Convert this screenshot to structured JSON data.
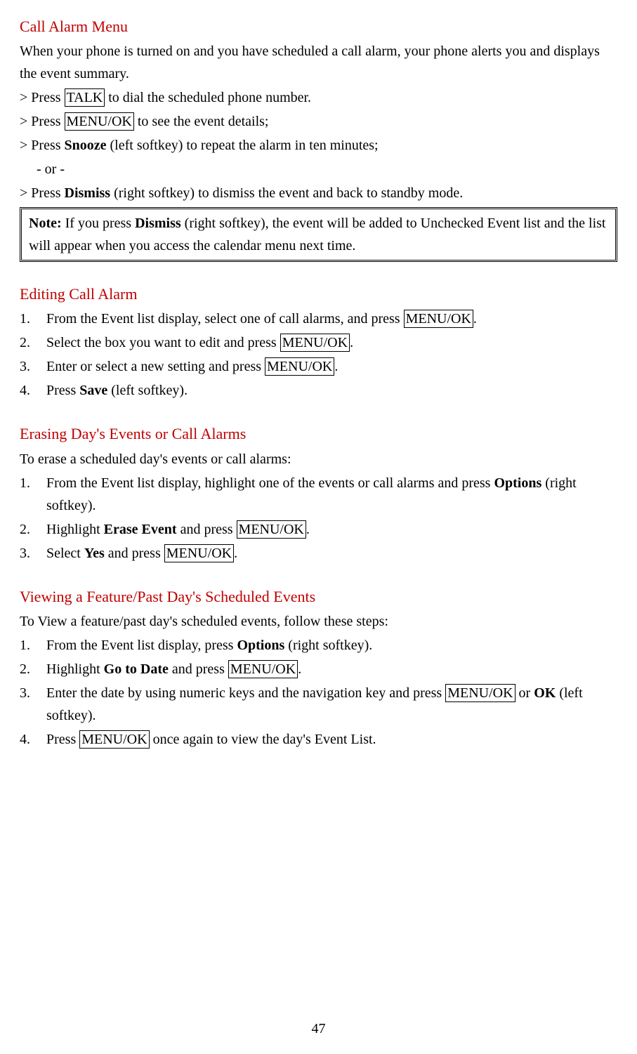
{
  "section1": {
    "heading": "Call Alarm Menu",
    "intro": "When your phone is turned on and you have scheduled a call alarm, your phone alerts you and displays the event summary.",
    "b1_a": "> Press ",
    "b1_key": "TALK",
    "b1_b": " to dial the scheduled phone number.",
    "b2_a": "> Press ",
    "b2_key": "MENU/OK",
    "b2_b": " to see the event details;",
    "b3_a": "> Press ",
    "b3_bold": "Snooze",
    "b3_b": " (left softkey) to repeat the alarm in ten minutes;",
    "or": "- or -",
    "b4_a": "> Press ",
    "b4_bold": "Dismiss",
    "b4_b": " (right softkey) to dismiss the event and back to standby mode.",
    "note_label": "Note:",
    "note_a": " If you press ",
    "note_bold": "Dismiss",
    "note_b": " (right softkey), the event will be added to Unchecked Event list and the list will appear when you access the calendar menu next time."
  },
  "section2": {
    "heading": "Editing Call Alarm",
    "i1_n": "1.",
    "i1_a": "From the Event list display, select one of call alarms, and press ",
    "i1_key": "MENU/OK",
    "i1_b": ".",
    "i2_n": "2.",
    "i2_a": "Select the box you want to edit and press ",
    "i2_key": "MENU/OK",
    "i2_b": ".",
    "i3_n": "3.",
    "i3_a": "Enter or select a new setting and press ",
    "i3_key": "MENU/OK",
    "i3_b": ".",
    "i4_n": "4.",
    "i4_a": "Press ",
    "i4_bold": "Save",
    "i4_b": " (left softkey)."
  },
  "section3": {
    "heading": "Erasing Day's Events or Call Alarms",
    "intro": "To erase a scheduled day's events or call alarms:",
    "i1_n": "1.",
    "i1_a": "From the Event list display, highlight one of the events or call alarms and press ",
    "i1_bold": "Options",
    "i1_b": " (right softkey).",
    "i2_n": "2.",
    "i2_a": "Highlight ",
    "i2_bold": "Erase Event",
    "i2_b": " and press ",
    "i2_key": "MENU/OK",
    "i2_c": ".",
    "i3_n": "3.",
    "i3_a": "Select ",
    "i3_bold": "Yes",
    "i3_b": " and press ",
    "i3_key": "MENU/OK",
    "i3_c": "."
  },
  "section4": {
    "heading": "Viewing a Feature/Past Day's Scheduled Events",
    "intro": "To View a feature/past day's scheduled events, follow these steps:",
    "i1_n": "1.",
    "i1_a": "From the Event list display, press ",
    "i1_bold": "Options",
    "i1_b": " (right softkey).",
    "i2_n": "2.",
    "i2_a": "Highlight ",
    "i2_bold": "Go to Date",
    "i2_b": " and press ",
    "i2_key": "MENU/OK",
    "i2_c": ".",
    "i3_n": "3.",
    "i3_a": "Enter the date by using numeric keys and the navigation key and press ",
    "i3_key": "MENU/OK",
    "i3_b": " or ",
    "i3_bold": "OK",
    "i3_c": " (left softkey).",
    "i4_n": "4.",
    "i4_a": "Press ",
    "i4_key": "MENU/OK",
    "i4_b": " once again to view the day's Event List."
  },
  "page_number": "47"
}
